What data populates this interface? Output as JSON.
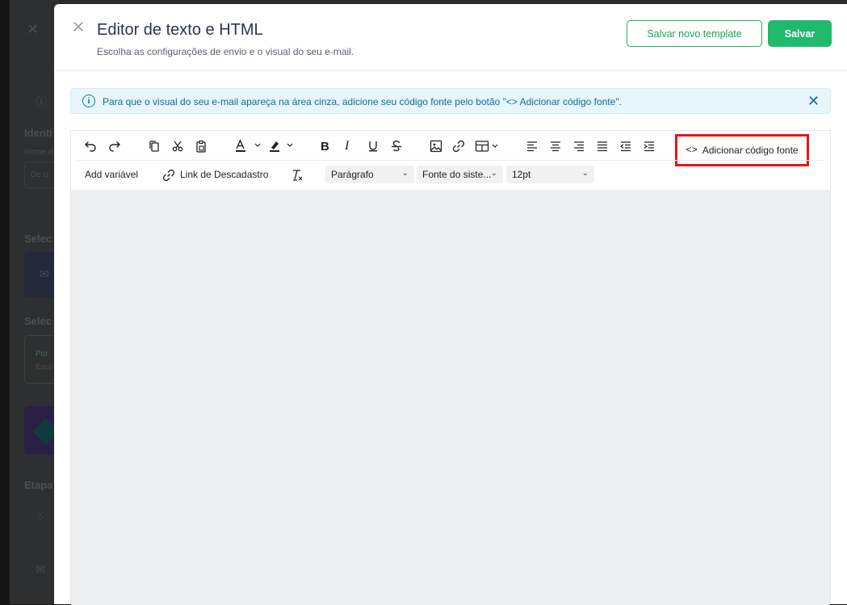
{
  "background": {
    "labels": [
      "Identi",
      "Nome d",
      "Selec",
      "Selec",
      "Etapa"
    ],
    "small": [
      "De u",
      "Por",
      "Esco"
    ]
  },
  "modal": {
    "title": "Editor de texto e HTML",
    "subtitle": "Escolha as configurações de envio e o visual do seu e-mail.",
    "save_template_label": "Salvar novo template",
    "save_label": "Salvar"
  },
  "banner": {
    "text": "Para que o visual do seu e-mail apareça na área cinza, adicione seu código fonte pelo botão \"<> Adicionar código fonte\".",
    "icon": "info-icon"
  },
  "toolbar": {
    "add_source_label": "Adicionar código fonte",
    "add_variable_label": "Add variável",
    "unsubscribe_link_label": "Link de Descadastro",
    "paragraph_select": "Parágrafo",
    "font_select": "Fonte do siste...",
    "size_select": "12pt"
  },
  "colors": {
    "accent_green": "#1fba6c",
    "banner_text": "#0e6f95",
    "highlight_red": "#e3161d",
    "canvas_gray": "#eeeff1"
  }
}
